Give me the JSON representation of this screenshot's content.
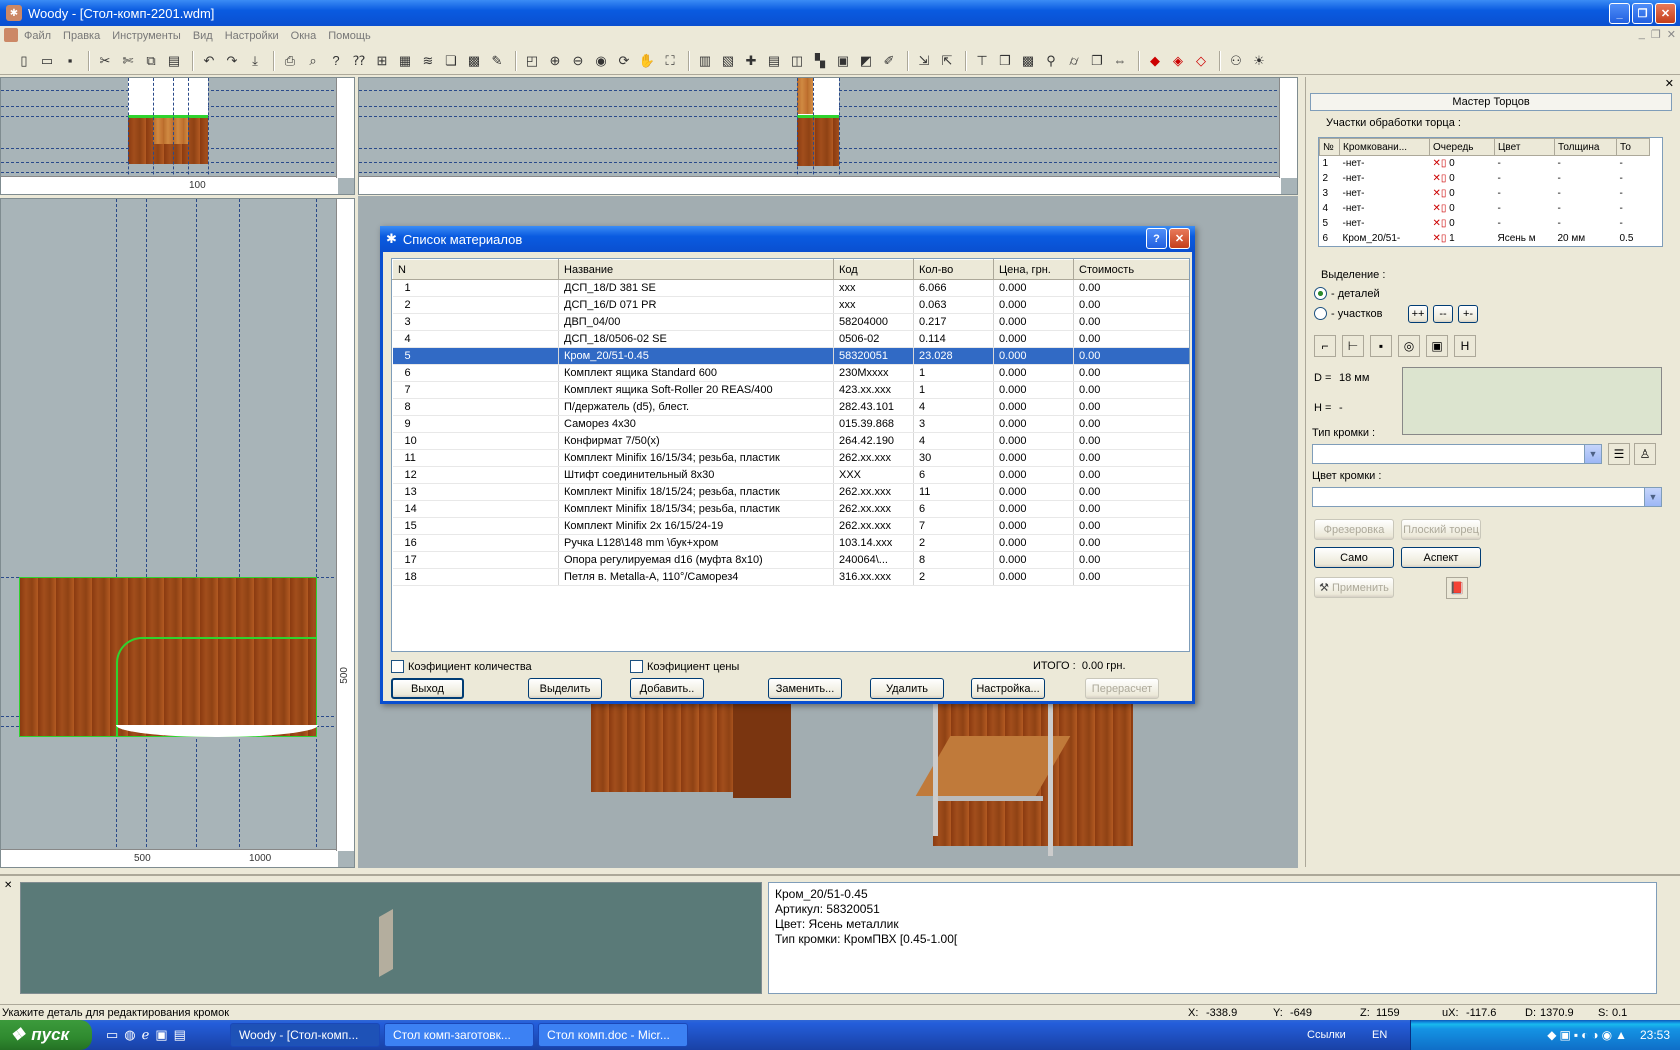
{
  "window": {
    "title": "Woody - [Стол-комп-2201.wdm]"
  },
  "menu": [
    "Файл",
    "Правка",
    "Инструменты",
    "Вид",
    "Настройки",
    "Окна",
    "Помощь"
  ],
  "toolbar_icons": [
    "new-icon",
    "open-icon",
    "save-icon",
    "cut-icon",
    "scissors-icon",
    "copy-icon",
    "paste-icon",
    "undo-icon",
    "redo-icon",
    "print-icon",
    "preview-icon",
    "help-icon",
    "whatis-icon"
  ],
  "views": {
    "top_left": {
      "ruler_label": "100"
    },
    "top_right": {},
    "left": {
      "ruler_500": "500",
      "ruler_1000": "1000",
      "vruler": "500"
    }
  },
  "dialog": {
    "title": "Список материалов",
    "columns": [
      "N",
      "Название",
      "Код",
      "Кол-во",
      "Цена, грн.",
      "Стоимость"
    ],
    "rows": [
      [
        "1",
        "ДСП_18/D 381 SE",
        "xxx",
        "6.066",
        "0.000",
        "0.00"
      ],
      [
        "2",
        "ДСП_16/D 071 PR",
        "xxx",
        "0.063",
        "0.000",
        "0.00"
      ],
      [
        "3",
        "ДВП_04/00",
        "58204000",
        "0.217",
        "0.000",
        "0.00"
      ],
      [
        "4",
        "ДСП_18/0506-02 SE",
        "0506-02",
        "0.114",
        "0.000",
        "0.00"
      ],
      [
        "5",
        "Кром_20/51-0.45",
        "58320051",
        "23.028",
        "0.000",
        "0.00"
      ],
      [
        "6",
        "Комплект ящика Standard 600",
        "230Mxxxx",
        "1",
        "0.000",
        "0.00"
      ],
      [
        "7",
        "Комплект ящика Soft-Roller 20 REAS/400",
        "423.xx.xxx",
        "1",
        "0.000",
        "0.00"
      ],
      [
        "8",
        "П/держатель (d5), блест.",
        "282.43.101",
        "4",
        "0.000",
        "0.00"
      ],
      [
        "9",
        "Саморез 4x30",
        "015.39.868",
        "3",
        "0.000",
        "0.00"
      ],
      [
        "10",
        "Конфирмат 7/50(x)",
        "264.42.190",
        "4",
        "0.000",
        "0.00"
      ],
      [
        "11",
        "Комплект Minifix 16/15/34; резьба, пластик",
        "262.xx.xxx",
        "30",
        "0.000",
        "0.00"
      ],
      [
        "12",
        "Штифт соединительный 8x30",
        "XXX",
        "6",
        "0.000",
        "0.00"
      ],
      [
        "13",
        "Комплект Minifix 18/15/24; резьба, пластик",
        "262.xx.xxx",
        "11",
        "0.000",
        "0.00"
      ],
      [
        "14",
        "Комплект Minifix 18/15/34; резьба, пластик",
        "262.xx.xxx",
        "6",
        "0.000",
        "0.00"
      ],
      [
        "15",
        "Комплект Minifix 2x 16/15/24-19",
        "262.xx.xxx",
        "7",
        "0.000",
        "0.00"
      ],
      [
        "16",
        "Ручка L128\\148 mm \\бук+хром",
        "103.14.xxx",
        "2",
        "0.000",
        "0.00"
      ],
      [
        "17",
        "Опора регулируемая d16 (муфта 8x10)",
        "240064\\...",
        "8",
        "0.000",
        "0.00"
      ],
      [
        "18",
        "Петля в. Metalla-A, 110°/Саморез4",
        "316.xx.xxx",
        "2",
        "0.000",
        "0.00"
      ]
    ],
    "selected_row": 4,
    "qty_coef": "Коэфициент количества",
    "price_coef": "Коэфициент цены",
    "total_label": "ИТОГО :",
    "total_value": "0.00 грн.",
    "buttons": {
      "exit": "Выход",
      "select": "Выделить",
      "add": "Добавить..",
      "replace": "Заменить...",
      "delete": "Удалить",
      "settings": "Настройка...",
      "recalc": "Перерасчет"
    }
  },
  "master": {
    "title": "Мастер Торцов",
    "section": "Участки обработки торца :",
    "columns": [
      "№",
      "Кромковани...",
      "Очередь",
      "Цвет",
      "Толщина",
      "То"
    ],
    "rows": [
      [
        "1",
        "-нет-",
        "0",
        "-",
        "-",
        "-"
      ],
      [
        "2",
        "-нет-",
        "0",
        "-",
        "-",
        "-"
      ],
      [
        "3",
        "-нет-",
        "0",
        "-",
        "-",
        "-"
      ],
      [
        "4",
        "-нет-",
        "0",
        "-",
        "-",
        "-"
      ],
      [
        "5",
        "-нет-",
        "0",
        "-",
        "-",
        "-"
      ],
      [
        "6",
        "Кром_20/51-",
        "1",
        "Ясень м",
        "20 мм",
        "0.5"
      ]
    ],
    "selection_label": "Выделение :",
    "radio_parts": "- деталей",
    "radio_sections": "- участков",
    "sel_btns": [
      "++",
      "--",
      "+-"
    ],
    "d_label": "D =",
    "d_value": "18 мм",
    "h_label": "H =",
    "h_value": "-",
    "edge_type_label": "Тип кромки :",
    "edge_color_label": "Цвет кромки :",
    "btn_mill": "Фрезеровка",
    "btn_flat": "Плоский торец",
    "btn_self": "Само",
    "btn_aspect": "Аспект",
    "btn_apply": "Применить"
  },
  "info": [
    "Кром_20/51-0.45",
    "Артикул: 58320051",
    "Цвет: Ясень металлик",
    "Тип кромки: КромПВХ [0.45-1.00["
  ],
  "status": {
    "hint": "Укажите деталь для редактирования кромок",
    "x_label": "X:",
    "x": "-338.9",
    "y_label": "Y:",
    "y": "-649",
    "z_label": "Z:",
    "z": "1159",
    "ux_label": "uX:",
    "ux": "-117.6",
    "d_label": "D:",
    "d": "1370.9",
    "s_label": "S:",
    "s": "0.1"
  },
  "taskbar": {
    "start": "пуск",
    "tasks": [
      "Woody - [Стол-комп...",
      "Стол комп-заготовк...",
      "Стол комп.doc - Micr..."
    ],
    "links": "Ссылки",
    "lang": "EN",
    "clock": "23:53"
  }
}
